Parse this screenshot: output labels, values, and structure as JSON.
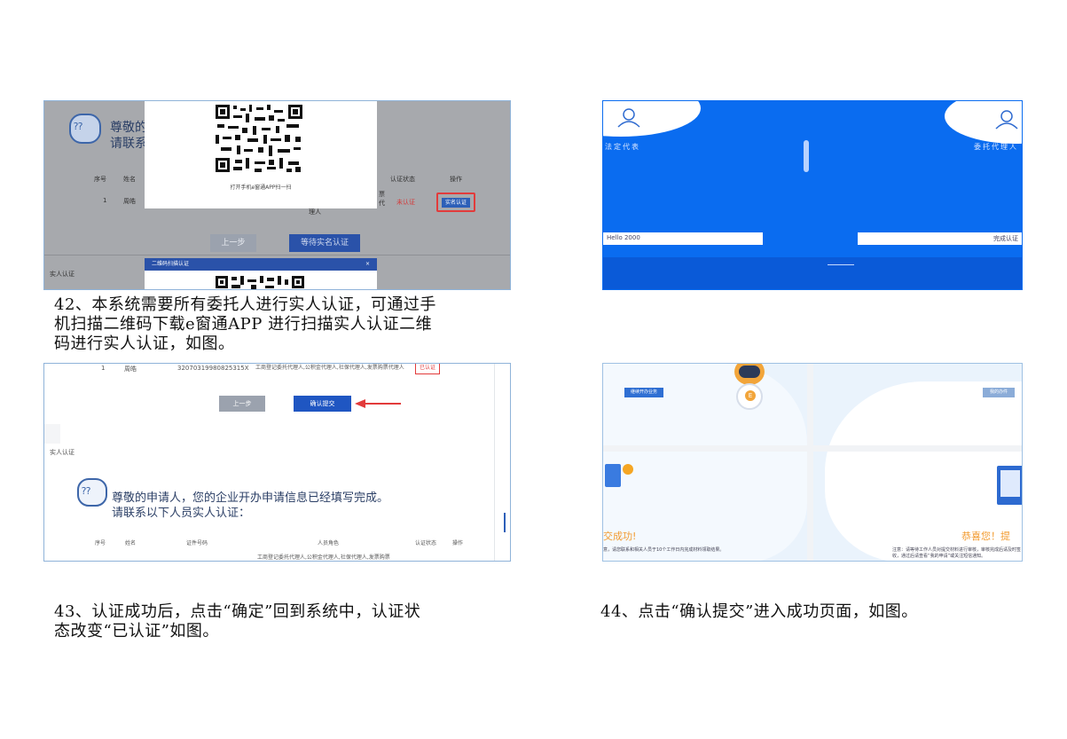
{
  "captions": {
    "c42": [
      "42、本系统需要所有委托人进行实人认证，可通过手",
      "机扫描二维码下载e窗通APP 进行扫描实人认证二维",
      "码进行实人认证，如图。"
    ],
    "c43": [
      "43、认证成功后，点击“确定”回到系统中，认证状",
      "态改变“已认证”如图。"
    ],
    "c44": "44、点击“确认提交”进入成功页面，如图。"
  },
  "panel1": {
    "greeting_line1": "尊敬的",
    "greeting_line2": "请联系",
    "columns": [
      "序号",
      "姓名",
      "认证状态",
      "操作"
    ],
    "row": {
      "index": "1",
      "name": "周皓",
      "role_fragment_1": "票",
      "role_fragment_2": "代",
      "role_fragment_3": "理人",
      "status": "未认证",
      "action": "实名认证"
    },
    "modal_scan_text": "打开手机e窗通APP扫一扫",
    "prev_button": "上一步",
    "wait_button": "等待实名认证",
    "section_label": "实人认证",
    "qr_dialog_title": "二维码扫描认证",
    "qr_dialog_close": "×"
  },
  "panel2": {
    "left_label": "法定代表",
    "right_label": "委托代理人",
    "left_input": "Hello 2000",
    "right_input": "完成认证"
  },
  "panel3": {
    "row_index": "1",
    "row_name": "周皓",
    "row_id": "32070319980825315X",
    "row_roles": "工商登记委托代理人,公积金代理人,社保代理人,发票购票代理人",
    "row_status": "已认证",
    "prev_button": "上一步",
    "confirm_button": "确认提交",
    "section_label": "实人认证",
    "greeting_line1": "尊敬的申请人，您的企业开办申请信息已经填写完成。",
    "greeting_line2": "请联系以下人员实人认证：",
    "columns": [
      "序号",
      "姓名",
      "证件号码",
      "人员角色",
      "认证状态",
      "操作"
    ],
    "row2_roles": "工商登记委托代理人,公积金代理人,社保代理人,发票购票"
  },
  "panel4": {
    "left_button": "继续开办业务",
    "right_button": "我的办件",
    "success_left": "交成功!",
    "success_right": "恭喜您！提",
    "note_left": "意，请您联系和相关人员于10个工作日内完成材料领取结果。",
    "note_right": "注意：请等待工作人员对提交材料进行审核，审核完成后请及时签收，通过后请查看“我的申请”或关注短信通知。",
    "robot_badge": "E"
  }
}
